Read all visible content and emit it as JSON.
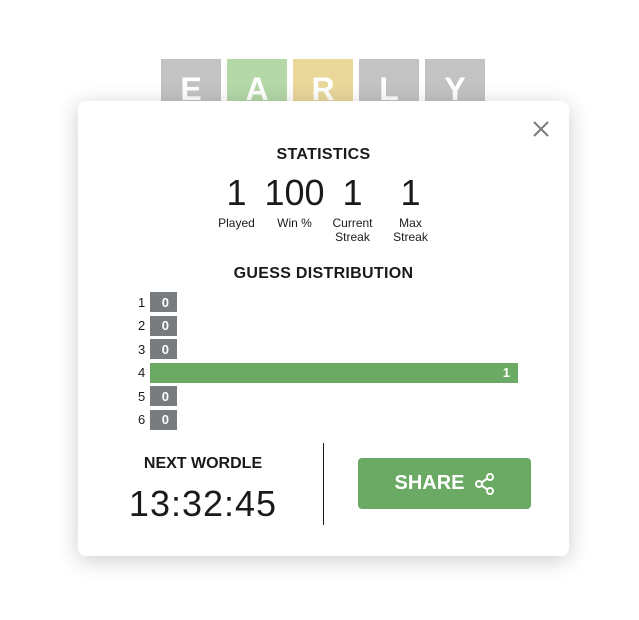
{
  "board": {
    "tiles": [
      {
        "letter": "E",
        "state": "absent"
      },
      {
        "letter": "A",
        "state": "correct"
      },
      {
        "letter": "R",
        "state": "present"
      },
      {
        "letter": "L",
        "state": "absent"
      },
      {
        "letter": "Y",
        "state": "absent"
      }
    ]
  },
  "modal": {
    "close_icon": "close-icon",
    "statistics_title": "STATISTICS",
    "stats": [
      {
        "value": "1",
        "label": "Played"
      },
      {
        "value": "100",
        "label": "Win %"
      },
      {
        "value": "1",
        "label": "Current Streak"
      },
      {
        "value": "1",
        "label": "Max Streak"
      }
    ],
    "distribution_title": "GUESS DISTRIBUTION",
    "distribution": [
      {
        "guess": "1",
        "count": 0,
        "highlight": false
      },
      {
        "guess": "2",
        "count": 0,
        "highlight": false
      },
      {
        "guess": "3",
        "count": 0,
        "highlight": false
      },
      {
        "guess": "4",
        "count": 1,
        "highlight": true
      },
      {
        "guess": "5",
        "count": 0,
        "highlight": false
      },
      {
        "guess": "6",
        "count": 0,
        "highlight": false
      }
    ],
    "next_title": "NEXT WORDLE",
    "countdown": "13:32:45",
    "share_label": "SHARE",
    "share_icon": "share-icon"
  },
  "colors": {
    "correct": "#6aaa64",
    "absent_bar": "#787c7e"
  }
}
